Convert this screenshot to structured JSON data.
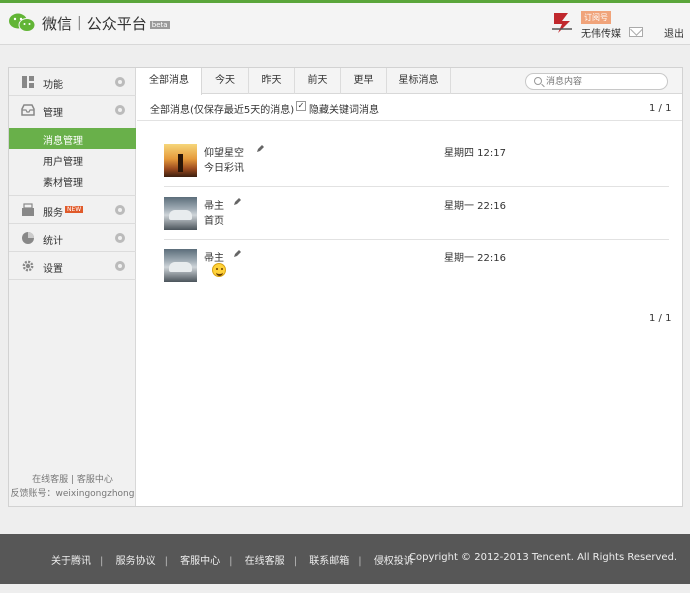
{
  "header": {
    "logo_text": "微信",
    "platform_text": "公众平台",
    "beta_badge": "beta",
    "account_type": "订阅号",
    "account_name": "无伟传媒",
    "logout": "退出"
  },
  "sidebar": {
    "items": [
      {
        "label": "功能",
        "icon": "grid-icon"
      },
      {
        "label": "管理",
        "icon": "inbox-icon"
      },
      {
        "label": "服务",
        "badge": "NEW",
        "icon": "basket-icon"
      },
      {
        "label": "统计",
        "icon": "pie-icon"
      },
      {
        "label": "设置",
        "icon": "gear-icon"
      }
    ],
    "subitems": [
      {
        "label": "消息管理",
        "active": true
      },
      {
        "label": "用户管理",
        "active": false
      },
      {
        "label": "素材管理",
        "active": false
      }
    ],
    "footer_line1": "在线客服 | 客服中心",
    "footer_line2": "反馈账号：weixingongzhong"
  },
  "tabs": [
    "全部消息",
    "今天",
    "昨天",
    "前天",
    "更早",
    "星标消息"
  ],
  "search": {
    "placeholder": "消息内容"
  },
  "filter": {
    "text": "全部消息(仅保存最近5天的消息)",
    "checkbox_label": "隐藏关键词消息",
    "checked": true
  },
  "pager": {
    "top": "1 / 1",
    "bottom": "1 / 1"
  },
  "messages": [
    {
      "sender": "仰望星空",
      "time": "星期四 12:17",
      "preview": "今日彩讯",
      "avatar": "sunset"
    },
    {
      "sender": "帚主",
      "time": "星期一 22:16",
      "preview": "首页",
      "avatar": "car"
    },
    {
      "sender": "帚主",
      "time": "星期一 22:16",
      "preview": "",
      "emoji": "smile-emoji",
      "avatar": "car"
    }
  ],
  "footer": {
    "links": [
      "关于腾讯",
      "服务协议",
      "客服中心",
      "在线客服",
      "联系邮箱",
      "侵权投诉"
    ],
    "copyright": "Copyright © 2012-2013 Tencent. All Rights Reserved."
  },
  "colors": {
    "accent": "#69b04a",
    "footer_bg": "#575757",
    "top_line": "#5aa53a"
  }
}
